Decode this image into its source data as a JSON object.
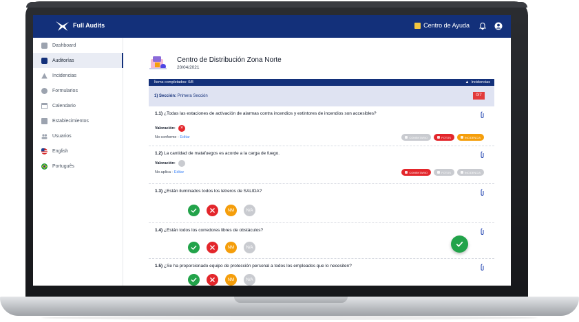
{
  "app": {
    "name": "Full Audits",
    "help_label": "Centro de Ayuda"
  },
  "sidebar": {
    "items": [
      {
        "label": "Dashboard",
        "icon": "grid-icon",
        "active": false
      },
      {
        "label": "Auditorías",
        "icon": "checkbox-icon",
        "active": true
      },
      {
        "label": "Incidencias",
        "icon": "warning-icon",
        "active": false
      },
      {
        "label": "Formularios",
        "icon": "check-circle-icon",
        "active": false
      },
      {
        "label": "Calendario",
        "icon": "calendar-icon",
        "active": false
      },
      {
        "label": "Establecimientos",
        "icon": "store-icon",
        "active": false
      },
      {
        "label": "Usuarios",
        "icon": "users-icon",
        "active": false
      },
      {
        "label": "English",
        "icon": "us-flag-icon",
        "active": false
      },
      {
        "label": "Português",
        "icon": "brazil-flag-icon",
        "active": false
      }
    ]
  },
  "audit": {
    "title": "Centro de Distribución Zona Norte",
    "date": "20/04/2021",
    "progress_text": "Ítems completados: 0/8",
    "incidents_label": "Incidencias",
    "section_prefix": "1) Sección:",
    "section_name": "Primera Sección",
    "section_count": "0/7"
  },
  "questions": [
    {
      "num": "1.1)",
      "text": "¿Todas las estaciones de activación de alarmas contra incendios y extintores de incendios son accesibles?",
      "valoracion_label": "Valoración:",
      "status": "No conforme",
      "edit_label": "Editar",
      "pills": [
        {
          "label": "COMENTARIO",
          "color": "#c9cbd0"
        },
        {
          "label": "FOTOS",
          "color": "#e3262b"
        },
        {
          "label": "INCIDENCIA",
          "color": "#f59e0b"
        }
      ]
    },
    {
      "num": "1.2)",
      "text": "La cantidad de matafuegos es acorde a la carga de fuego.",
      "valoracion_label": "Valoración:",
      "status": "No aplica",
      "edit_label": "Editar",
      "pills": [
        {
          "label": "COMENTARIO",
          "color": "#e3262b"
        },
        {
          "label": "FOTOS",
          "color": "#c9cbd0"
        },
        {
          "label": "INCIDENCIA",
          "color": "#c9cbd0"
        }
      ]
    },
    {
      "num": "1.3)",
      "text": "¿Están iluminados todos los letreros de SALIDA?"
    },
    {
      "num": "1.4)",
      "text": "¿Están todos los corredores libres de obstáculos?"
    },
    {
      "num": "1.5)",
      "text": "¿Se ha proporcionado equipo de protección personal a todos los empleados que lo necesiten?"
    }
  ],
  "options": {
    "nm": "NM",
    "na": "N/A"
  },
  "colors": {
    "brand": "#13307a",
    "green": "#22a34a",
    "red": "#e3262b",
    "orange": "#f59e0b",
    "gray": "#c9cbd0"
  }
}
